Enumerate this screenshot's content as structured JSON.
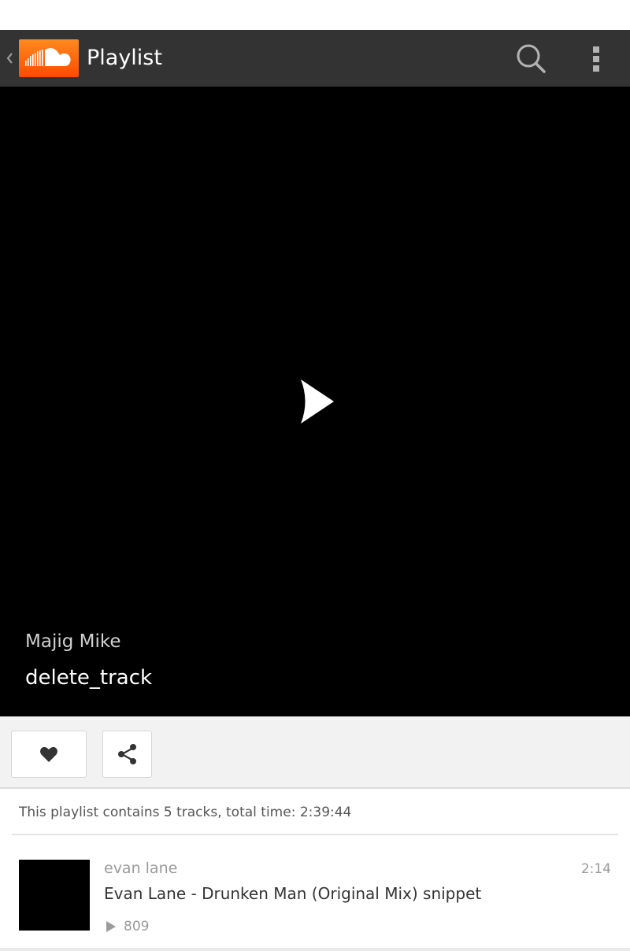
{
  "header": {
    "title": "Playlist",
    "logo_icon": "soundcloud-logo",
    "search_icon": "search-icon",
    "overflow_icon": "overflow-menu-icon",
    "accent": "#ff5500"
  },
  "artwork": {
    "user": "Majig Mike",
    "title": "delete_track",
    "play_icon": "play-icon"
  },
  "actions": {
    "like_icon": "heart-icon",
    "share_icon": "share-icon"
  },
  "playlist": {
    "summary": "This playlist contains 5 tracks, total time: 2:39:44"
  },
  "tracks": [
    {
      "user": "evan lane",
      "title": "Evan Lane - Drunken Man (Original Mix) snippet",
      "duration": "2:14",
      "plays": "809"
    }
  ]
}
